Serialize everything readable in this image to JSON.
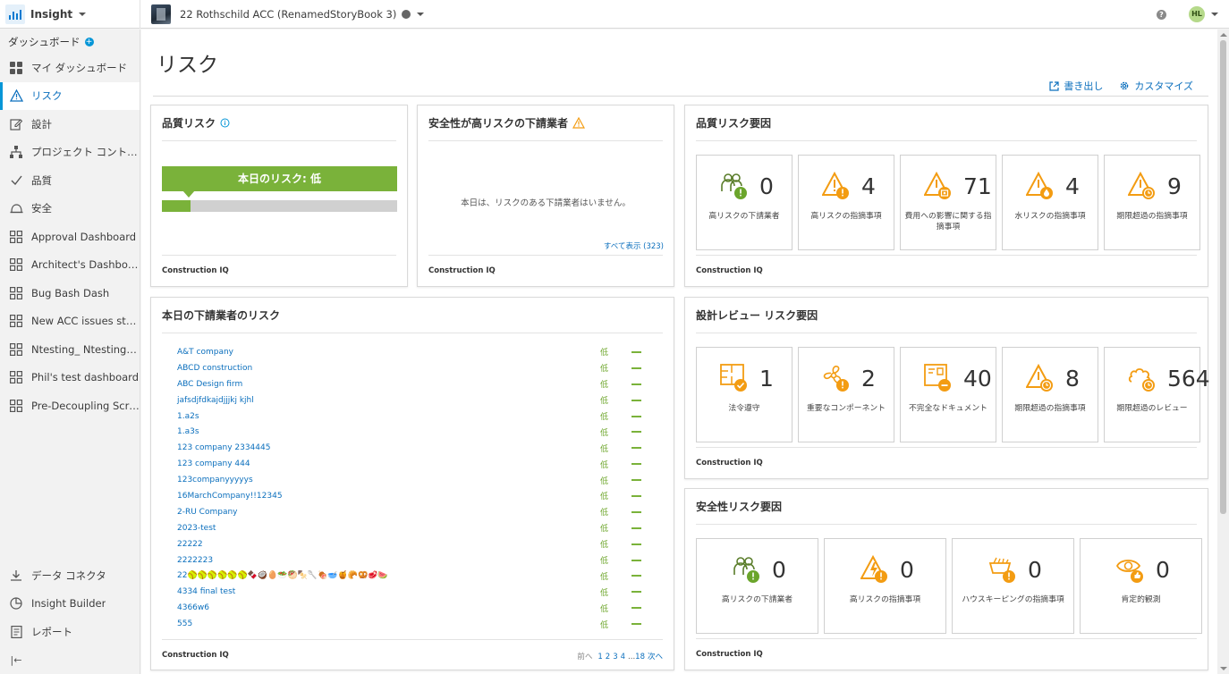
{
  "topbar": {
    "app_name": "Insight",
    "project_name": "22 Rothschild ACC (RenamedStoryBook 3)",
    "help_icon": "question-icon",
    "help_glyph": "?",
    "user_initials": "HL"
  },
  "sidebar": {
    "header": "ダッシュボード",
    "plus_glyph": "+",
    "items": [
      {
        "label": "マイ ダッシュボード",
        "icon": "grid-icon"
      },
      {
        "label": "リスク",
        "icon": "warning-icon",
        "active": true
      },
      {
        "label": "設計",
        "icon": "edit-icon"
      },
      {
        "label": "プロジェクト コントロ...",
        "icon": "hierarchy-icon"
      },
      {
        "label": "品質",
        "icon": "check-icon"
      },
      {
        "label": "安全",
        "icon": "hardhat-icon"
      },
      {
        "label": "Approval Dashboard",
        "icon": "grid-outline-icon"
      },
      {
        "label": "Architect's Dashboard",
        "icon": "grid-outline-icon"
      },
      {
        "label": "Bug Bash Dash",
        "icon": "grid-outline-icon"
      },
      {
        "label": "New ACC issues status...",
        "icon": "grid-outline-icon"
      },
      {
        "label": "Ntesting_ Ntesting_ N...",
        "icon": "grid-outline-icon"
      },
      {
        "label": "Phil's test dashboard",
        "icon": "grid-outline-icon"
      },
      {
        "label": "Pre-Decoupling Script ...",
        "icon": "grid-outline-icon"
      }
    ],
    "bottom": [
      {
        "label": "データ コネクタ",
        "icon": "download-icon"
      },
      {
        "label": "Insight Builder",
        "icon": "pie-icon"
      },
      {
        "label": "レポート",
        "icon": "report-icon"
      }
    ],
    "collapse_icon": "collapse-icon",
    "collapse_glyph": "|←"
  },
  "page": {
    "title": "リスク",
    "export_label": "書き出し",
    "customize_label": "カスタマイズ"
  },
  "quality_risk": {
    "title": "品質リスク",
    "info_glyph": "i",
    "banner": "本日のリスク: 低",
    "level_fraction": 0.12,
    "footer": "Construction IQ"
  },
  "high_risk_subs": {
    "title": "安全性が高リスクの下請業者",
    "message": "本日は、リスクのある下請業者はいません。",
    "see_all": "すべて表示 (323)",
    "footer": "Construction IQ"
  },
  "quality_factors": {
    "title": "品質リスク要因",
    "footer": "Construction IQ",
    "tiles": [
      {
        "value": "0",
        "label": "高リスクの下請業者",
        "icon": "people-warning-icon"
      },
      {
        "value": "4",
        "label": "高リスクの指摘事項",
        "icon": "warning-exclaim-icon"
      },
      {
        "value": "71",
        "label": "費用への影響に関する指摘事項",
        "icon": "warning-cost-icon"
      },
      {
        "value": "4",
        "label": "水リスクの指摘事項",
        "icon": "warning-water-icon"
      },
      {
        "value": "9",
        "label": "期限超過の指摘事項",
        "icon": "warning-clock-icon"
      }
    ]
  },
  "sub_risk_today": {
    "title": "本日の下請業者のリスク",
    "footer": "Construction IQ",
    "level_label": "低",
    "rows": [
      "A&T company",
      "ABCD construction",
      "ABC Design firm",
      "jafsdjfdkajdjjjkj kjhl",
      "1.a2s",
      "1.a3s",
      "123 company 2334445",
      "123 company 444",
      "123companyyyyys",
      "16MarchCompany!!12345",
      "2-RU Company",
      "2023-test",
      "22222",
      "2222223",
      "22🥎🥎🥎🥎🥎🥎🍫🥥🥚🥗🥙🍢🥄🍖🥣🍯🥐🥨🥩🍉",
      "4334 final test",
      "4366w6",
      "555"
    ],
    "pager": {
      "prev": "前へ",
      "pages": [
        "1",
        "2",
        "3",
        "4"
      ],
      "ellipsis": "...",
      "last": "18",
      "next": "次へ"
    }
  },
  "design_review": {
    "title": "設計レビュー リスク要因",
    "footer": "Construction IQ",
    "tiles": [
      {
        "value": "1",
        "label": "法令遵守",
        "icon": "plan-check-icon"
      },
      {
        "value": "2",
        "label": "重要なコンポーネント",
        "icon": "fan-warning-icon"
      },
      {
        "value": "40",
        "label": "不完全なドキュメント",
        "icon": "document-minus-icon"
      },
      {
        "value": "8",
        "label": "期限超過の指摘事項",
        "icon": "warning-clock-icon"
      },
      {
        "value": "564",
        "label": "期限超過のレビュー",
        "icon": "cloud-clock-icon"
      }
    ]
  },
  "safety_factors": {
    "title": "安全性リスク要因",
    "footer": "Construction IQ",
    "tiles": [
      {
        "value": "0",
        "label": "高リスクの下請業者",
        "icon": "people-warning-icon"
      },
      {
        "value": "0",
        "label": "高リスクの指摘事項",
        "icon": "warning-bolt-icon"
      },
      {
        "value": "0",
        "label": "ハウスキーピングの指摘事項",
        "icon": "cart-warning-icon"
      },
      {
        "value": "0",
        "label": "肯定的観測",
        "icon": "eye-thumb-icon"
      }
    ]
  },
  "colors": {
    "accent": "#0696d7",
    "link": "#0b6fbd",
    "low_risk": "#7ab23a",
    "icon_orange": "#f39c12"
  }
}
